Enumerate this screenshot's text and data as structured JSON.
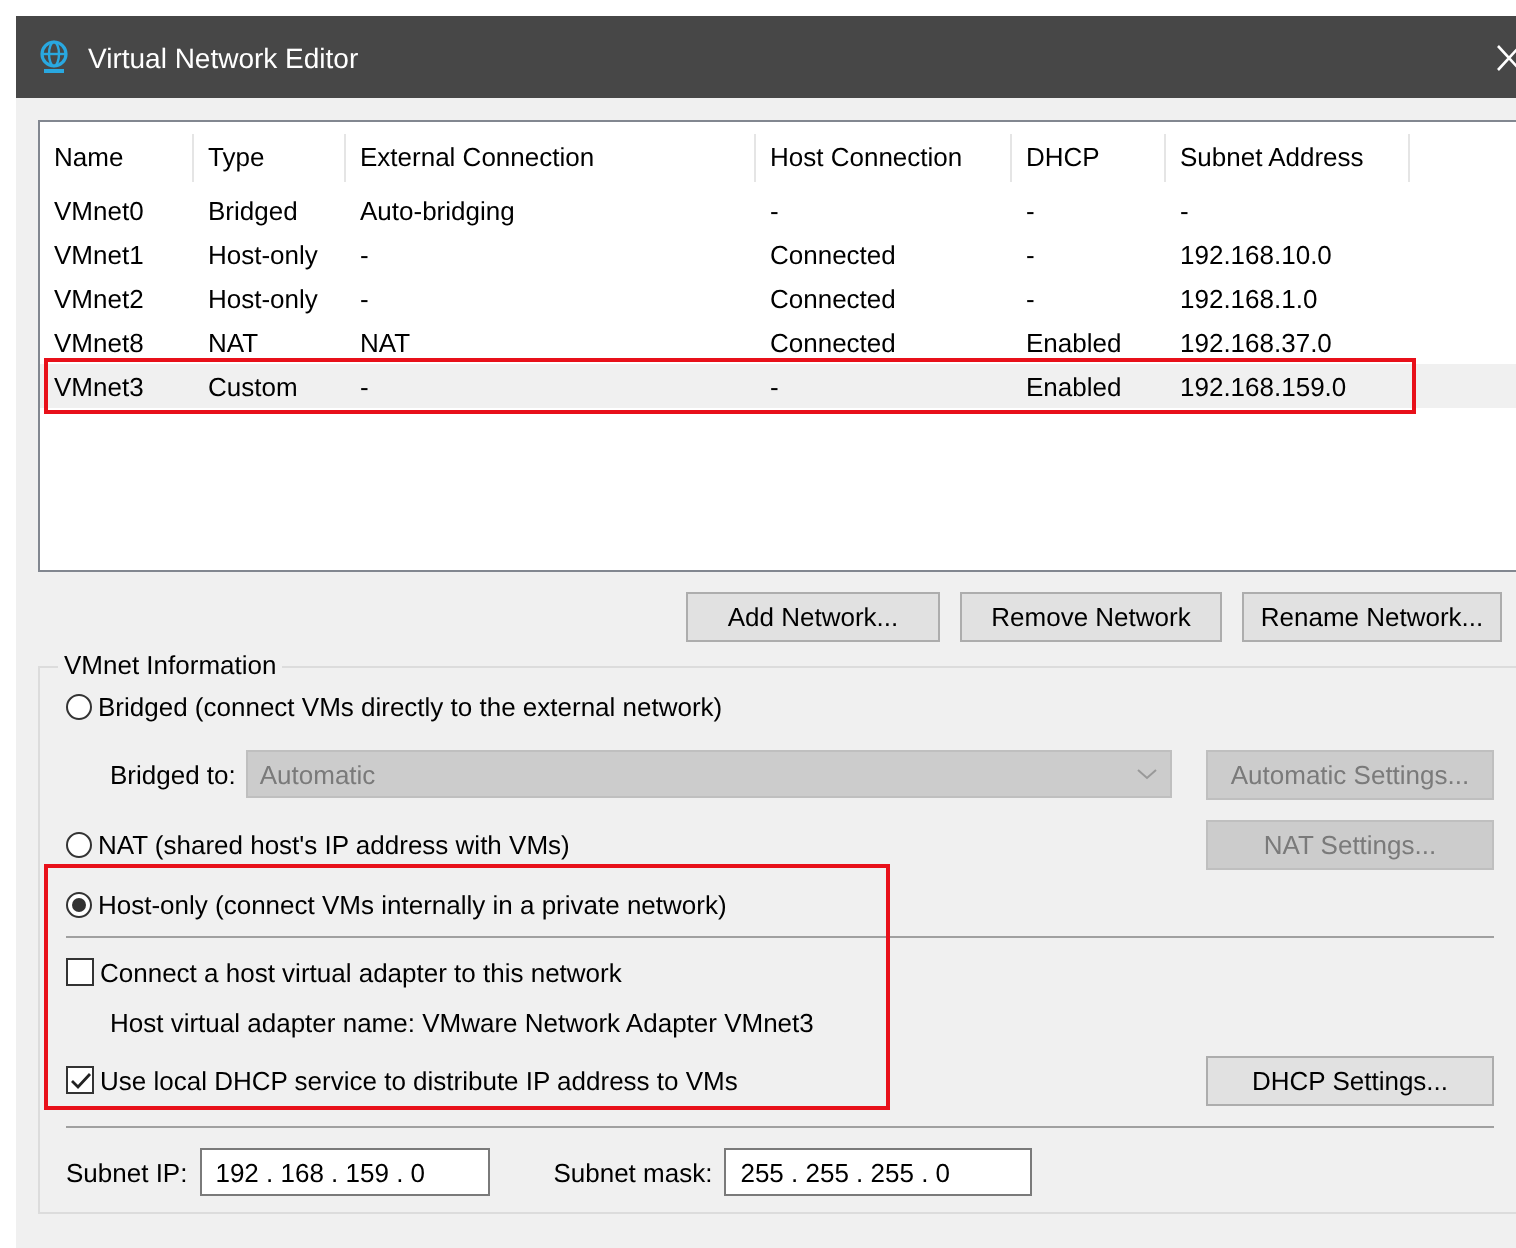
{
  "window": {
    "title": "Virtual Network Editor"
  },
  "table": {
    "columns": [
      "Name",
      "Type",
      "External Connection",
      "Host Connection",
      "DHCP",
      "Subnet Address"
    ],
    "rows": [
      {
        "cells": [
          "VMnet0",
          "Bridged",
          "Auto-bridging",
          "-",
          "-",
          "-"
        ],
        "selected": false,
        "highlighted": false
      },
      {
        "cells": [
          "VMnet1",
          "Host-only",
          "-",
          "Connected",
          "-",
          "192.168.10.0"
        ],
        "selected": false,
        "highlighted": false
      },
      {
        "cells": [
          "VMnet2",
          "Host-only",
          "-",
          "Connected",
          "-",
          "192.168.1.0"
        ],
        "selected": false,
        "highlighted": false
      },
      {
        "cells": [
          "VMnet8",
          "NAT",
          "NAT",
          "Connected",
          "Enabled",
          "192.168.37.0"
        ],
        "selected": false,
        "highlighted": false
      },
      {
        "cells": [
          "VMnet3",
          "Custom",
          "-",
          "-",
          "Enabled",
          "192.168.159.0"
        ],
        "selected": true,
        "highlighted": true
      }
    ]
  },
  "list_buttons": [
    "Add Network...",
    "Remove Network",
    "Rename Network..."
  ],
  "vmnet_information": {
    "title": "VMnet Information",
    "bridged": {
      "label": "Bridged (connect VMs directly to the external network)",
      "selected": false
    },
    "bridged_to": {
      "label": "Bridged to:",
      "value": "Automatic",
      "disabled": true,
      "button": "Automatic Settings..."
    },
    "nat": {
      "label": "NAT (shared host's IP address with VMs)",
      "selected": false,
      "button": "NAT Settings...",
      "button_disabled": true
    },
    "host_only": {
      "label": "Host-only (connect VMs internally in a private network)",
      "selected": true,
      "highlighted": true
    },
    "connect_adapter": {
      "label": "Connect a host virtual adapter to this network",
      "checked": false
    },
    "adapter_name": "Host virtual adapter name: VMware Network Adapter VMnet3",
    "use_dhcp": {
      "label": "Use local DHCP service to distribute IP address to VMs",
      "checked": true
    },
    "dhcp_button": "DHCP Settings...",
    "subnet_ip": {
      "label": "Subnet IP:",
      "value": "192 . 168 . 159 .  0"
    },
    "subnet_mask": {
      "label": "Subnet mask:",
      "value": "255 . 255 . 255 .  0"
    }
  }
}
